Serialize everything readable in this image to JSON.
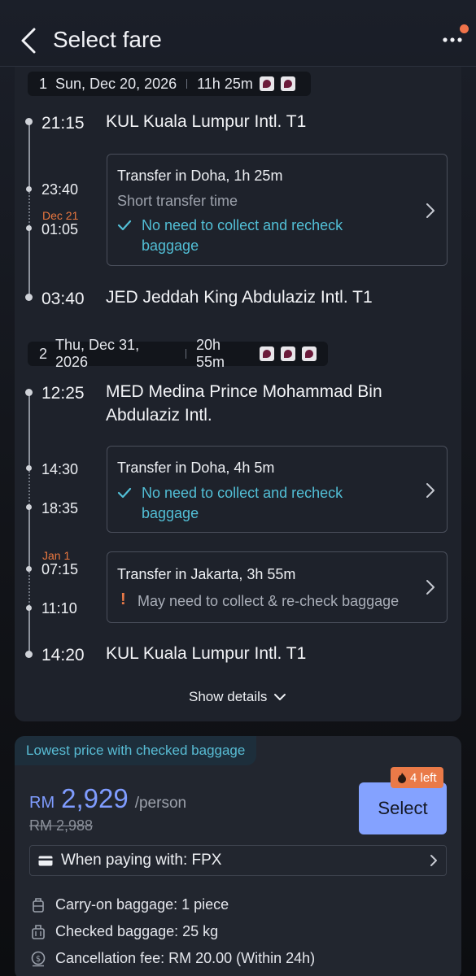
{
  "header": {
    "title": "Select fare",
    "back_icon": "chevron-left-icon",
    "more_icon": "more-dots-icon"
  },
  "segments": [
    {
      "num": "1",
      "date": "Sun, Dec 20, 2026",
      "duration": "11h 25m",
      "airlines": [
        "airline-logo",
        "airline-logo"
      ],
      "depart_time": "21:15",
      "depart_place": "KUL Kuala Lumpur Intl. T1",
      "transfers": [
        {
          "arrive": "23:40",
          "next_day": "Dec 21",
          "depart": "01:05",
          "title": "Transfer in Doha, 1h 25m",
          "note": "Short transfer time",
          "baggage_ok_line1": "No need to collect and recheck",
          "baggage_ok_line2": "baggage"
        }
      ],
      "arrive_time": "03:40",
      "arrive_place": "JED Jeddah King Abdulaziz Intl. T1"
    },
    {
      "num": "2",
      "date": "Thu, Dec 31, 2026",
      "duration": "20h 55m",
      "airlines": [
        "airline-logo",
        "airline-logo",
        "airline-logo"
      ],
      "depart_time": "12:25",
      "depart_place_line1": "MED Medina Prince Mohammad Bin",
      "depart_place_line2": "Abdulaziz Intl.",
      "transfers": [
        {
          "arrive": "14:30",
          "depart": "18:35",
          "title": "Transfer in Doha, 4h 5m",
          "baggage_ok_line1": "No need to collect and recheck",
          "baggage_ok_line2": "baggage"
        },
        {
          "next_day": "Jan 1",
          "arrive": "07:15",
          "depart": "11:10",
          "title": "Transfer in Jakarta, 3h 55m",
          "warning": "May need to collect & re-check baggage"
        }
      ],
      "arrive_time": "14:20",
      "arrive_place": "KUL Kuala Lumpur Intl. T1"
    }
  ],
  "show_details": "Show details",
  "fare": {
    "tag": "Lowest price with checked baggage",
    "currency": "RM",
    "amount": "2,929",
    "per": "/person",
    "original": "RM 2,988",
    "seats_left": "4 left",
    "select_label": "Select",
    "payment": "When paying with: FPX",
    "features": [
      {
        "icon": "carry-on-bag-icon",
        "text": "Carry-on baggage: 1 piece"
      },
      {
        "icon": "checked-bag-icon",
        "text": "Checked baggage: 25 kg"
      },
      {
        "icon": "money-refund-icon",
        "text": "Cancellation fee: RM 20.00 (Within 24h)"
      }
    ]
  },
  "colors": {
    "accent": "#84a2ff",
    "teal": "#52bfd6",
    "orange": "#ea7a48",
    "card": "#1e222b"
  }
}
